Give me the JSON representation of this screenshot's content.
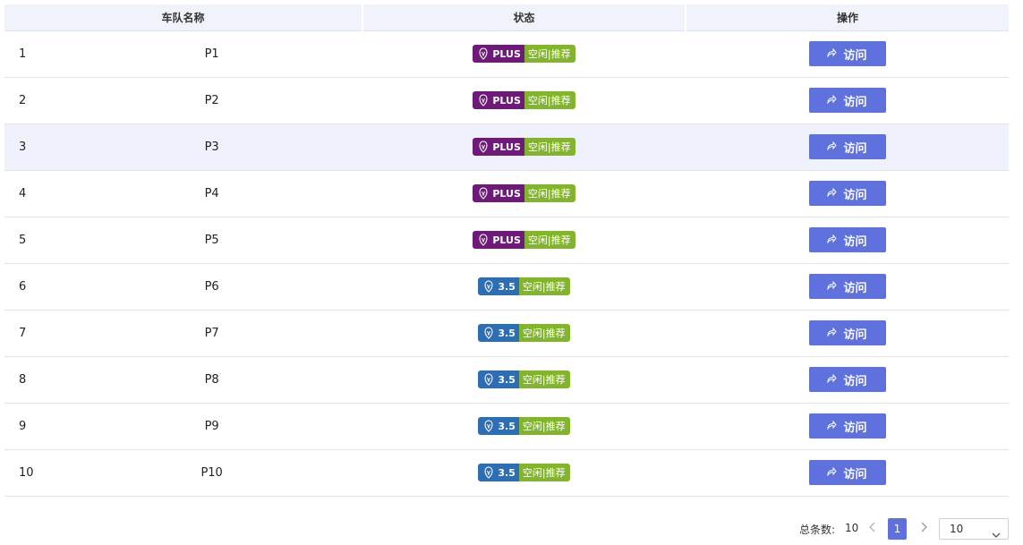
{
  "table": {
    "headers": {
      "name": "车队名称",
      "status": "状态",
      "action": "操作"
    },
    "rows": [
      {
        "index": "1",
        "name": "P1",
        "tier": "PLUS",
        "tier_type": "plus",
        "state": "空闲|推荐",
        "action": "访问"
      },
      {
        "index": "2",
        "name": "P2",
        "tier": "PLUS",
        "tier_type": "plus",
        "state": "空闲|推荐",
        "action": "访问"
      },
      {
        "index": "3",
        "name": "P3",
        "tier": "PLUS",
        "tier_type": "plus",
        "state": "空闲|推荐",
        "action": "访问"
      },
      {
        "index": "4",
        "name": "P4",
        "tier": "PLUS",
        "tier_type": "plus",
        "state": "空闲|推荐",
        "action": "访问"
      },
      {
        "index": "5",
        "name": "P5",
        "tier": "PLUS",
        "tier_type": "plus",
        "state": "空闲|推荐",
        "action": "访问"
      },
      {
        "index": "6",
        "name": "P6",
        "tier": "3.5",
        "tier_type": "v35",
        "state": "空闲|推荐",
        "action": "访问"
      },
      {
        "index": "7",
        "name": "P7",
        "tier": "3.5",
        "tier_type": "v35",
        "state": "空闲|推荐",
        "action": "访问"
      },
      {
        "index": "8",
        "name": "P8",
        "tier": "3.5",
        "tier_type": "v35",
        "state": "空闲|推荐",
        "action": "访问"
      },
      {
        "index": "9",
        "name": "P9",
        "tier": "3.5",
        "tier_type": "v35",
        "state": "空闲|推荐",
        "action": "访问"
      },
      {
        "index": "10",
        "name": "P10",
        "tier": "3.5",
        "tier_type": "v35",
        "state": "空闲|推荐",
        "action": "访问"
      }
    ]
  },
  "pagination": {
    "total_label": "总条数:",
    "total": "10",
    "current_page": "1",
    "page_size": "10",
    "prev_icon": "chevron-left-icon",
    "next_icon": "chevron-right-icon"
  },
  "icons": {
    "tier": "openai-logo-icon",
    "visit": "share-arrow-icon",
    "size": "chevron-down-icon"
  },
  "colors": {
    "plus": "#6e1a78",
    "v35": "#2d6db3",
    "state": "#82b52c",
    "primary": "#5e71dc",
    "header_bg": "#f0f3fc",
    "row_highlight": "#eff2fc"
  }
}
